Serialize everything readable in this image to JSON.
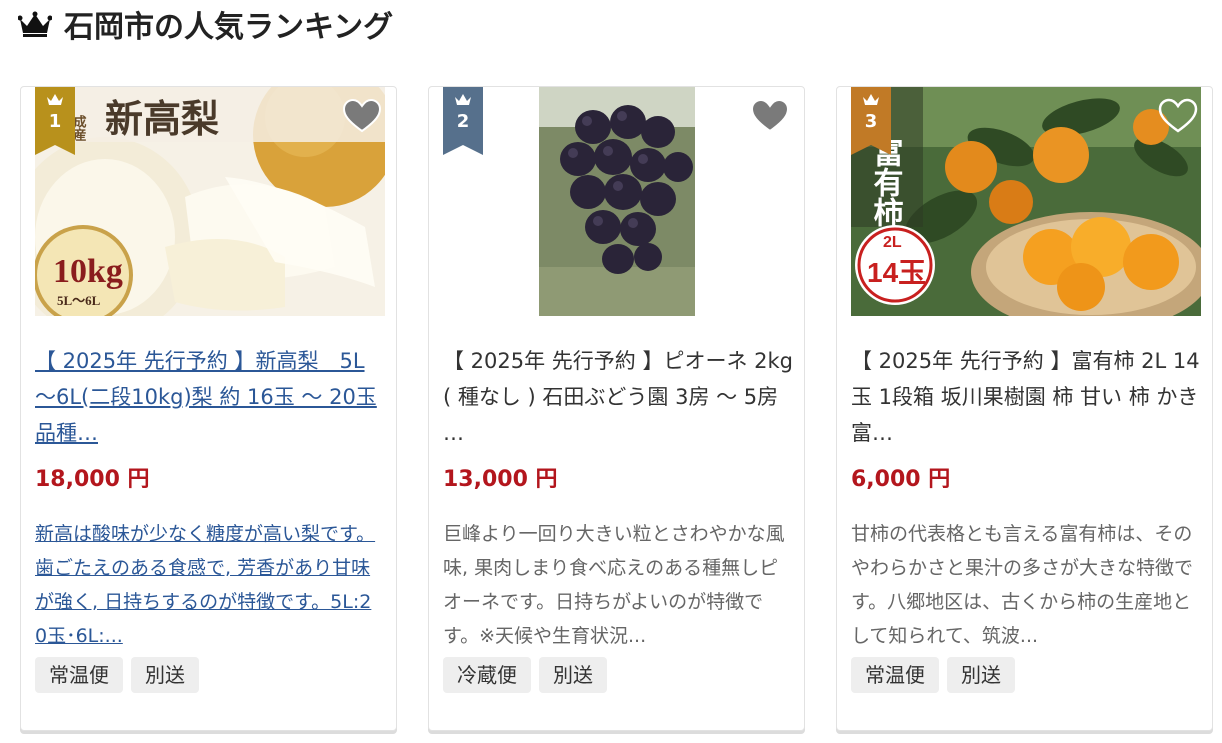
{
  "header": {
    "title": "石岡市の人気ランキング"
  },
  "colors": {
    "gold": "#b8911c",
    "slate": "#56708c",
    "bronze": "#c17a26",
    "price": "#b3161d",
    "link": "#2b5797"
  },
  "cards": [
    {
      "rank": "1",
      "image_text": {
        "variety": "新高梨",
        "badge_main": "10kg",
        "badge_sub": "5L～6L",
        "side": "成産"
      },
      "title": "【 2025年 先行予約 】新高梨　5L～6L(二段10kg)梨 約 16玉 ～ 20玉 品種…",
      "price": "18,000 円",
      "description": "新高は酸味が少なく糖度が高い梨です。歯ごたえのある食感で, 芳香があり甘味が強く, 日持ちするのが特徴です。5L:20玉･6L:...",
      "tags": [
        "常温便",
        "別送"
      ]
    },
    {
      "rank": "2",
      "title": "【 2025年 先行予約 】ピオーネ 2kg ( 種なし ) 石田ぶどう園 3房 ～ 5房 …",
      "price": "13,000 円",
      "description": "巨峰より一回り大きい粒とさわやかな風味, 果肉しまり食べ応えのある種無しピオーネです。日持ちがよいのが特徴です。※天候や生育状況...",
      "tags": [
        "冷蔵便",
        "別送"
      ]
    },
    {
      "rank": "3",
      "image_text": {
        "variety": "富有柿",
        "badge_main": "14玉",
        "badge_sub": "2L"
      },
      "title": "【 2025年 先行予約 】富有柿 2L 14玉 1段箱 坂川果樹園 柿 甘い 柿 かき 富…",
      "price": "6,000 円",
      "description": "甘柿の代表格とも言える富有柿は、そのやわらかさと果汁の多さが大きな特徴です。八郷地区は、古くから柿の生産地として知られて、筑波...",
      "tags": [
        "常温便",
        "別送"
      ]
    }
  ]
}
